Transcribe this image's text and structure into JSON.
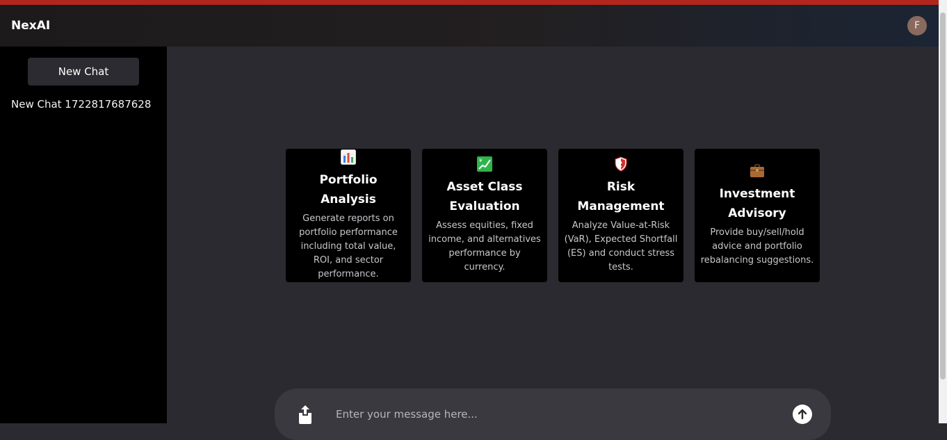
{
  "header": {
    "brand": "NexAI",
    "avatar_initial": "F"
  },
  "sidebar": {
    "new_chat_label": "New Chat",
    "history": [
      {
        "label": "New Chat 1722817687628"
      }
    ]
  },
  "cards": [
    {
      "icon": "bar-chart-icon",
      "title": "Portfolio Analysis",
      "description": "Generate reports on portfolio performance including total value, ROI, and sector performance."
    },
    {
      "icon": "chart-increasing-yen-icon",
      "title": "Asset Class Evaluation",
      "description": "Assess equities, fixed income, and alternatives performance by currency."
    },
    {
      "icon": "shield-icon",
      "title": "Risk Management",
      "description": "Analyze Value-at-Risk (VaR), Expected Shortfall (ES) and conduct stress tests."
    },
    {
      "icon": "briefcase-icon",
      "title": "Investment Advisory",
      "description": "Provide buy/sell/hold advice and portfolio rebalancing suggestions."
    }
  ],
  "composer": {
    "placeholder": "Enter your message here...",
    "value": ""
  },
  "colors": {
    "accent_strip": "#b3261e",
    "background": "#2b2a30",
    "sidebar": "#000000",
    "card": "#000000"
  }
}
